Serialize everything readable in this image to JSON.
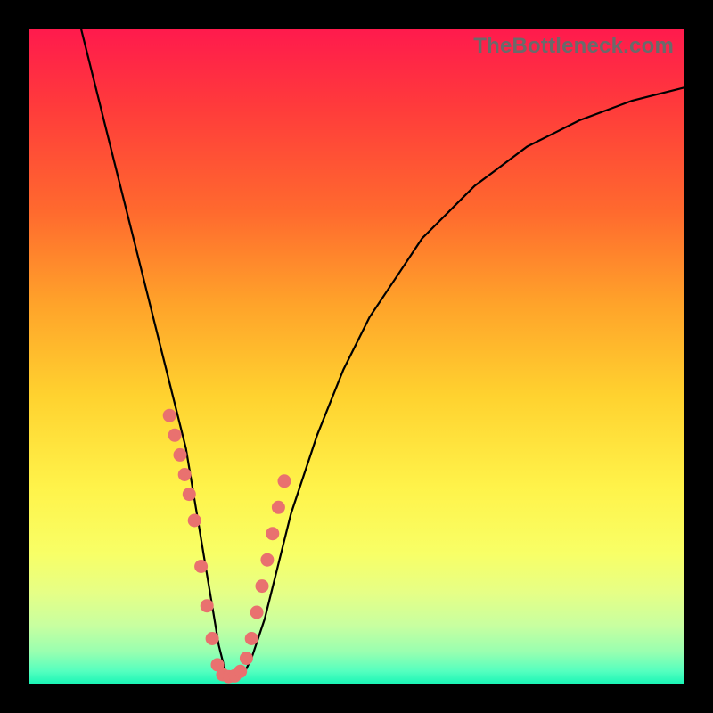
{
  "watermark": "TheBottleneck.com",
  "colors": {
    "gradient_top": "#ff1a4d",
    "gradient_bottom": "#17f5b6",
    "curve": "#000000",
    "dots": "#e9716f",
    "frame": "#000000"
  },
  "chart_data": {
    "type": "line",
    "title": "",
    "xlabel": "",
    "ylabel": "",
    "xlim": [
      0,
      100
    ],
    "ylim": [
      0,
      100
    ],
    "grid": false,
    "series": [
      {
        "name": "bottleneck-curve",
        "x": [
          8,
          10,
          12,
          14,
          16,
          18,
          20,
          22,
          24,
          26,
          27,
          28,
          29,
          30,
          31,
          32,
          33,
          34,
          36,
          38,
          40,
          44,
          48,
          52,
          56,
          60,
          64,
          68,
          72,
          76,
          80,
          84,
          88,
          92,
          96,
          100
        ],
        "y": [
          100,
          92,
          84,
          76,
          68,
          60,
          52,
          44,
          36,
          24,
          18,
          12,
          6,
          2,
          1,
          1,
          2,
          4,
          10,
          18,
          26,
          38,
          48,
          56,
          62,
          68,
          72,
          76,
          79,
          82,
          84,
          86,
          87.5,
          89,
          90,
          91
        ]
      }
    ],
    "scatter_points": {
      "name": "marker-dots",
      "x": [
        21.5,
        22.3,
        23.1,
        23.8,
        24.5,
        25.3,
        26.3,
        27.2,
        28.0,
        28.8,
        29.6,
        30.5,
        31.4,
        32.3,
        33.2,
        34.0,
        34.8,
        35.6,
        36.4,
        37.2,
        38.1,
        39.0
      ],
      "y": [
        41,
        38,
        35,
        32,
        29,
        25,
        18,
        12,
        7,
        3,
        1.5,
        1.2,
        1.3,
        2,
        4,
        7,
        11,
        15,
        19,
        23,
        27,
        31
      ]
    }
  }
}
